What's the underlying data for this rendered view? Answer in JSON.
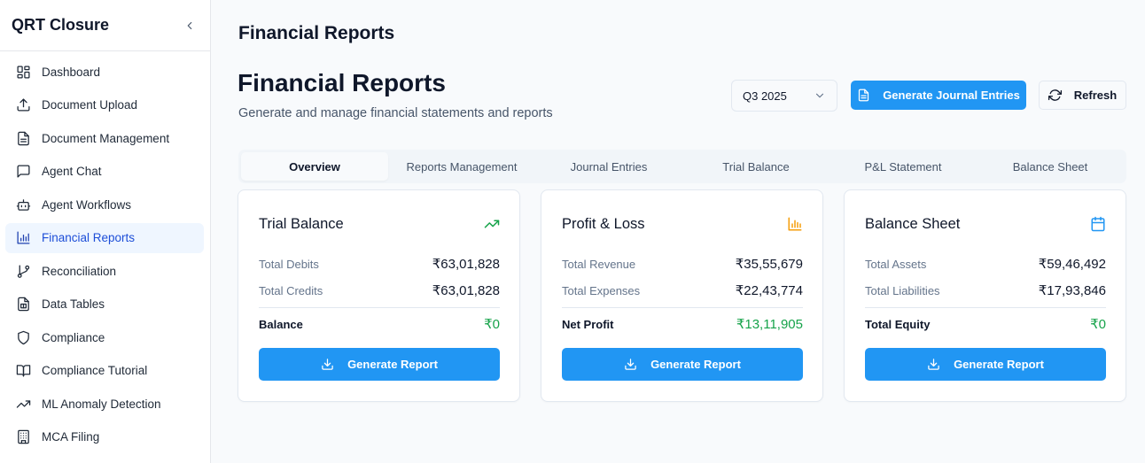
{
  "sidebar": {
    "title": "QRT Closure",
    "items": [
      {
        "label": "Dashboard",
        "icon": "dashboard-icon"
      },
      {
        "label": "Document Upload",
        "icon": "upload-icon"
      },
      {
        "label": "Document Management",
        "icon": "document-icon"
      },
      {
        "label": "Agent Chat",
        "icon": "chat-icon"
      },
      {
        "label": "Agent Workflows",
        "icon": "bot-icon"
      },
      {
        "label": "Financial Reports",
        "icon": "bar-chart-icon",
        "active": true
      },
      {
        "label": "Reconciliation",
        "icon": "git-merge-icon"
      },
      {
        "label": "Data Tables",
        "icon": "file-table-icon"
      },
      {
        "label": "Compliance",
        "icon": "shield-icon"
      },
      {
        "label": "Compliance Tutorial",
        "icon": "book-icon"
      },
      {
        "label": "ML Anomaly Detection",
        "icon": "trending-up-icon"
      },
      {
        "label": "MCA Filing",
        "icon": "building-icon"
      }
    ]
  },
  "header": {
    "title": "Financial Reports"
  },
  "page": {
    "title": "Financial Reports",
    "subtitle": "Generate and manage financial statements and reports",
    "period_select": "Q3 2025",
    "generate_button": "Generate Journal Entries",
    "refresh_button": "Refresh"
  },
  "tabs": [
    "Overview",
    "Reports Management",
    "Journal Entries",
    "Trial Balance",
    "P&L Statement",
    "Balance Sheet"
  ],
  "cards": [
    {
      "title": "Trial Balance",
      "icon": "trending-up-icon",
      "icon_color": "#16a34a",
      "rows": [
        {
          "label": "Total Debits",
          "value": "₹63,01,828"
        },
        {
          "label": "Total Credits",
          "value": "₹63,01,828"
        }
      ],
      "total": {
        "label": "Balance",
        "value": "₹0"
      },
      "button": "Generate Report"
    },
    {
      "title": "Profit & Loss",
      "icon": "bar-chart-icon",
      "icon_color": "#f59e0b",
      "rows": [
        {
          "label": "Total Revenue",
          "value": "₹35,55,679"
        },
        {
          "label": "Total Expenses",
          "value": "₹22,43,774"
        }
      ],
      "total": {
        "label": "Net Profit",
        "value": "₹13,11,905"
      },
      "button": "Generate Report"
    },
    {
      "title": "Balance Sheet",
      "icon": "calendar-icon",
      "icon_color": "#2196f3",
      "rows": [
        {
          "label": "Total Assets",
          "value": "₹59,46,492"
        },
        {
          "label": "Total Liabilities",
          "value": "₹17,93,846"
        }
      ],
      "total": {
        "label": "Total Equity",
        "value": "₹0"
      },
      "button": "Generate Report"
    }
  ],
  "colors": {
    "accent": "#2196f3",
    "positive": "#16a34a",
    "active_nav_bg": "#eff6ff"
  }
}
